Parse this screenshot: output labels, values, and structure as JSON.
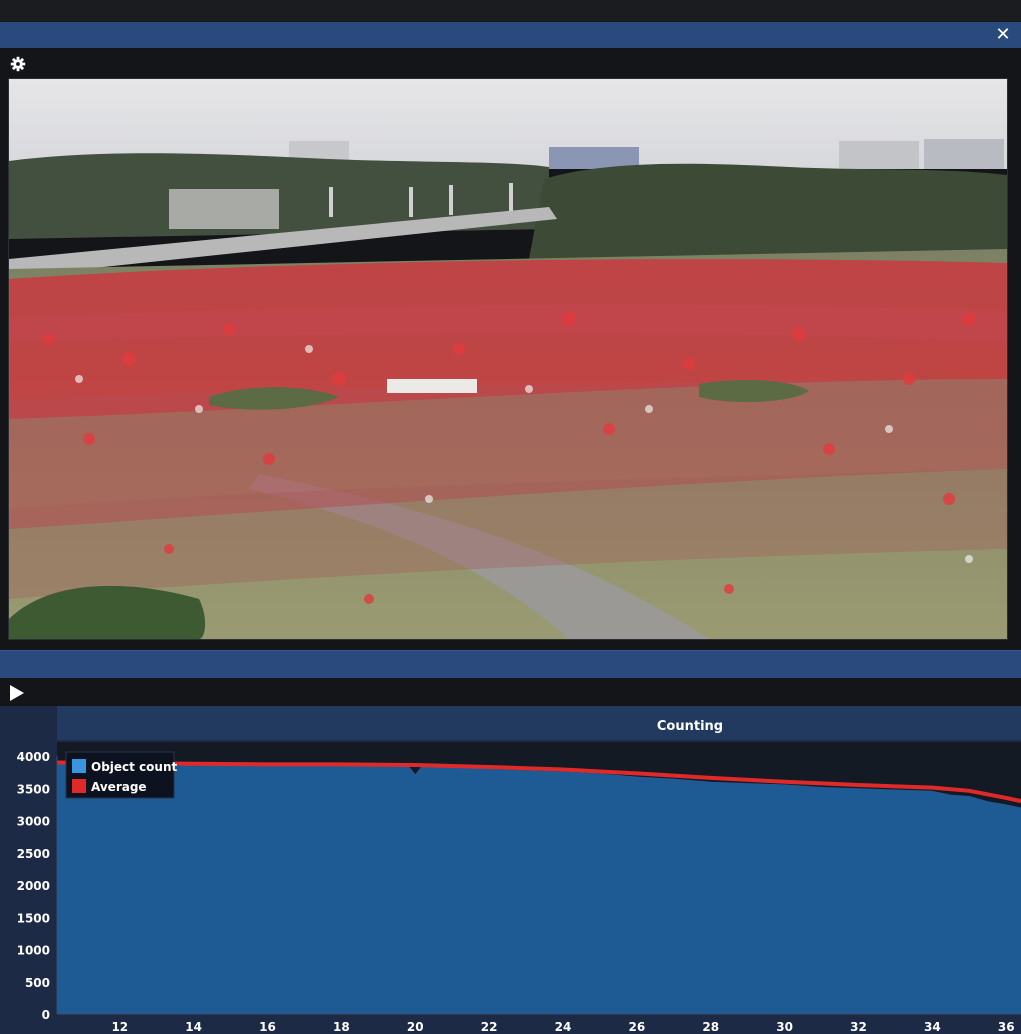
{
  "window": {
    "close_icon": "close-icon",
    "close_glyph": "✕"
  },
  "video": {
    "settings_icon": "gear-icon"
  },
  "controls": {
    "play_icon": "play-icon"
  },
  "colors": {
    "titlebar": "#2a4a7e",
    "plot_fill": "#1e5a94",
    "average_line": "#e02a2a",
    "count_legend": "#3a95e0",
    "chart_header": "#233a60"
  },
  "chart_data": {
    "type": "area",
    "title": "Counting",
    "xlabel": "",
    "ylabel": "",
    "xlim": [
      10.3,
      36.4
    ],
    "ylim": [
      0,
      4000
    ],
    "x_ticks": [
      "12",
      "14",
      "16",
      "18",
      "20",
      "22",
      "24",
      "26",
      "28",
      "30",
      "32",
      "34",
      "36"
    ],
    "y_ticks": [
      "0",
      "500",
      "1000",
      "1500",
      "2000",
      "2500",
      "3000",
      "3500",
      "4000"
    ],
    "grid": false,
    "legend_position": "top-left",
    "series": [
      {
        "name": "Object count",
        "x": [
          10.3,
          11,
          12,
          13,
          14,
          15,
          16,
          17,
          18,
          19,
          19.8,
          20,
          20.2,
          21,
          22,
          23,
          24,
          25,
          26,
          27,
          28,
          29,
          30,
          31,
          32,
          33,
          34,
          34.5,
          35,
          35.5,
          36,
          36.4
        ],
        "values": [
          3880,
          3890,
          3870,
          3880,
          3870,
          3860,
          3850,
          3870,
          3860,
          3850,
          3860,
          3720,
          3860,
          3840,
          3800,
          3780,
          3760,
          3730,
          3680,
          3650,
          3600,
          3580,
          3560,
          3520,
          3500,
          3480,
          3460,
          3400,
          3380,
          3300,
          3250,
          3200
        ]
      },
      {
        "name": "Average",
        "x": [
          10.3,
          12,
          14,
          16,
          18,
          20,
          22,
          24,
          26,
          28,
          30,
          32,
          34,
          35,
          36,
          36.4
        ],
        "values": [
          3900,
          3890,
          3880,
          3870,
          3870,
          3860,
          3830,
          3790,
          3730,
          3660,
          3600,
          3550,
          3510,
          3460,
          3350,
          3300
        ]
      }
    ]
  }
}
